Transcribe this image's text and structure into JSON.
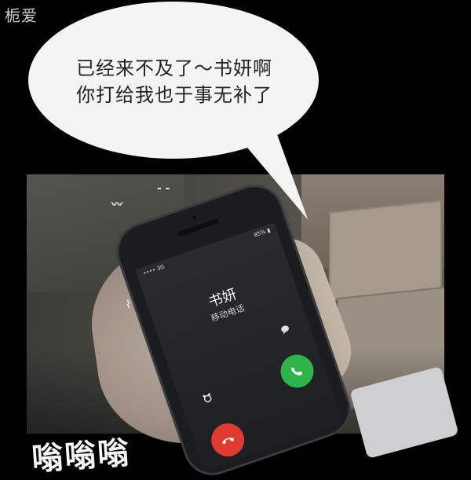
{
  "watermark": "栀爱",
  "bubble": {
    "line1": "已经来不及了～书妍啊",
    "line2": "你打给我也于事无补了"
  },
  "phone": {
    "status_left": "•••• 3G",
    "status_right": "85% ▮",
    "caller_name": "书妍",
    "caller_subtitle": "移动电话",
    "message_icon": "speech-bubble-icon",
    "alarm_icon": "alarm-clock-icon",
    "accept_icon": "phone-accept-icon",
    "decline_icon": "phone-decline-icon"
  },
  "sound_effect": "嗡嗡嗡",
  "colors": {
    "accept": "#2db44a",
    "decline": "#e03a31",
    "bubble": "#f4f4f4"
  }
}
